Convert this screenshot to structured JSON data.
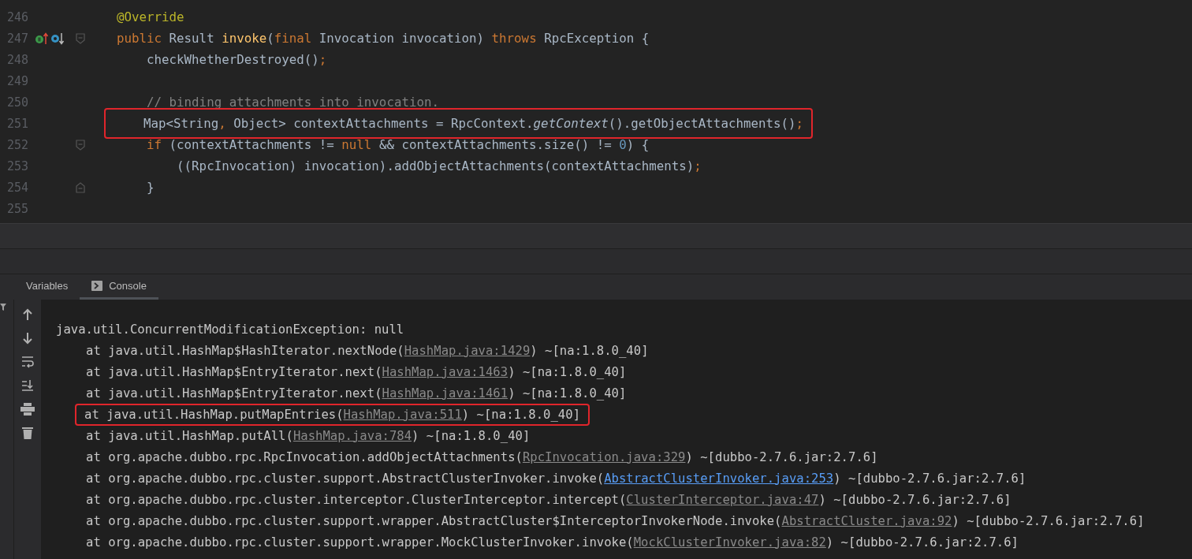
{
  "editor": {
    "lines": [
      {
        "number": "246",
        "tokens": [
          {
            "kind": "ann",
            "text": "@Override"
          }
        ]
      },
      {
        "number": "247",
        "gutter_icons": true,
        "fold_start": true,
        "tokens": [
          {
            "kind": "kw",
            "text": "public "
          },
          {
            "kind": "plain",
            "text": "Result "
          },
          {
            "kind": "fn",
            "text": "invoke"
          },
          {
            "kind": "plain",
            "text": "("
          },
          {
            "kind": "kw",
            "text": "final "
          },
          {
            "kind": "plain",
            "text": "Invocation invocation) "
          },
          {
            "kind": "kw",
            "text": "throws "
          },
          {
            "kind": "plain",
            "text": "RpcException {"
          }
        ]
      },
      {
        "number": "248",
        "tokens": [
          {
            "kind": "plain",
            "text": "    checkWhetherDestroyed()"
          },
          {
            "kind": "kw",
            "text": ";"
          }
        ]
      },
      {
        "number": "249"
      },
      {
        "number": "250",
        "tokens": [
          {
            "kind": "comment",
            "text": "    // binding attachments into invocation."
          }
        ]
      },
      {
        "number": "251",
        "highlighted": true,
        "tokens": [
          {
            "kind": "plain",
            "text": "    Map<String"
          },
          {
            "kind": "kw",
            "text": ","
          },
          {
            "kind": "plain",
            "text": " Object> contextAttachments = RpcContext."
          },
          {
            "kind": "italic",
            "text": "getContext"
          },
          {
            "kind": "plain",
            "text": "().getObjectAttachments()"
          },
          {
            "kind": "kw",
            "text": ";"
          }
        ]
      },
      {
        "number": "252",
        "fold_start": true,
        "tokens": [
          {
            "kind": "kw",
            "text": "    if "
          },
          {
            "kind": "plain",
            "text": "(contextAttachments != "
          },
          {
            "kind": "kw",
            "text": "null "
          },
          {
            "kind": "plain",
            "text": "&& contextAttachments.size() != "
          },
          {
            "kind": "num",
            "text": "0"
          },
          {
            "kind": "plain",
            "text": ") {"
          }
        ]
      },
      {
        "number": "253",
        "tokens": [
          {
            "kind": "plain",
            "text": "        ((RpcInvocation) invocation).addObjectAttachments(contextAttachments)"
          },
          {
            "kind": "kw",
            "text": ";"
          }
        ]
      },
      {
        "number": "254",
        "fold_end": true,
        "tokens": [
          {
            "kind": "plain",
            "text": "    }"
          }
        ]
      },
      {
        "number": "255"
      }
    ]
  },
  "bottom_panel": {
    "tabs": [
      {
        "label": "Variables",
        "selected": false
      },
      {
        "label": "Console",
        "selected": true
      }
    ]
  },
  "console": {
    "lines": [
      {
        "kind": "header",
        "text": "java.util.ConcurrentModificationException: null",
        "highlighted": false
      },
      {
        "kind": "frame",
        "text": "at java.util.HashMap$HashIterator.nextNode(",
        "link": "HashMap.java:1429",
        "link_visited": true,
        "suffix": ") ~[na:1.8.0_40]",
        "highlighted": false
      },
      {
        "kind": "frame",
        "text": "at java.util.HashMap$EntryIterator.next(",
        "link": "HashMap.java:1463",
        "link_visited": true,
        "suffix": ") ~[na:1.8.0_40]",
        "highlighted": false
      },
      {
        "kind": "frame",
        "text": "at java.util.HashMap$EntryIterator.next(",
        "link": "HashMap.java:1461",
        "link_visited": true,
        "suffix": ") ~[na:1.8.0_40]",
        "highlighted": false
      },
      {
        "kind": "frame",
        "text": "at java.util.HashMap.putMapEntries(",
        "link": "HashMap.java:511",
        "link_visited": true,
        "suffix": ") ~[na:1.8.0_40]",
        "highlighted": true
      },
      {
        "kind": "frame",
        "text": "at java.util.HashMap.putAll(",
        "link": "HashMap.java:784",
        "link_visited": true,
        "suffix": ") ~[na:1.8.0_40]",
        "highlighted": false
      },
      {
        "kind": "frame",
        "text": "at org.apache.dubbo.rpc.RpcInvocation.addObjectAttachments(",
        "link": "RpcInvocation.java:329",
        "link_visited": true,
        "suffix": ") ~[dubbo-2.7.6.jar:2.7.6]",
        "highlighted": false
      },
      {
        "kind": "frame",
        "text": "at org.apache.dubbo.rpc.cluster.support.AbstractClusterInvoker.invoke(",
        "link": "AbstractClusterInvoker.java:253",
        "link_visited": false,
        "suffix": ") ~[dubbo-2.7.6.jar:2.7.6]",
        "highlighted": false
      },
      {
        "kind": "frame",
        "text": "at org.apache.dubbo.rpc.cluster.interceptor.ClusterInterceptor.intercept(",
        "link": "ClusterInterceptor.java:47",
        "link_visited": true,
        "suffix": ") ~[dubbo-2.7.6.jar:2.7.6]",
        "highlighted": false
      },
      {
        "kind": "frame",
        "text": "at org.apache.dubbo.rpc.cluster.support.wrapper.AbstractCluster$InterceptorInvokerNode.invoke(",
        "link": "AbstractCluster.java:92",
        "link_visited": true,
        "suffix": ") ~[dubbo-2.7.6.jar:2.7.6]",
        "highlighted": false
      },
      {
        "kind": "frame",
        "text": "at org.apache.dubbo.rpc.cluster.support.wrapper.MockClusterInvoker.invoke(",
        "link": "MockClusterInvoker.java:82",
        "link_visited": true,
        "suffix": ") ~[dubbo-2.7.6.jar:2.7.6]",
        "highlighted": false
      }
    ]
  }
}
